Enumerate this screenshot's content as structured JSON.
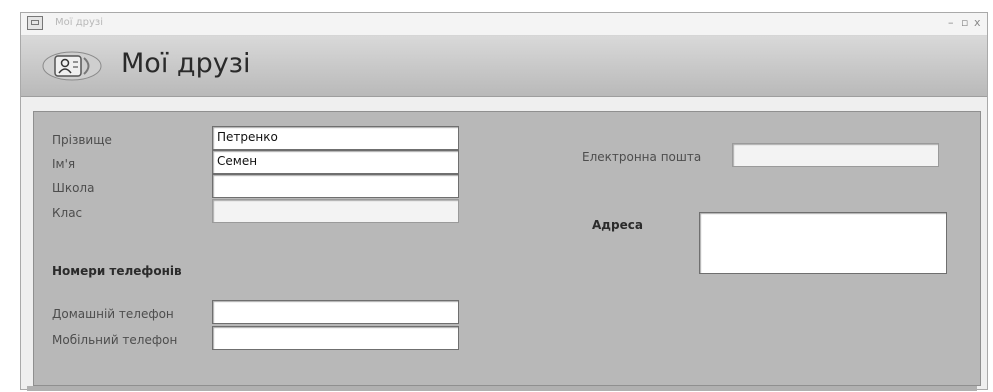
{
  "window": {
    "title": "Мої друзі",
    "minimize_glyph": "–",
    "restore_glyph": "▫",
    "close_glyph": "x"
  },
  "form": {
    "title": "Мої друзі"
  },
  "fields": {
    "surname": {
      "label": "Прізвище",
      "value": "Петренко"
    },
    "name": {
      "label": "Ім'я",
      "value": "Семен"
    },
    "school": {
      "label": "Школа",
      "value": ""
    },
    "class": {
      "label": "Клас",
      "value": ""
    },
    "phones_heading": "Номери телефонів",
    "home_phone": {
      "label": "Домашній телефон",
      "value": ""
    },
    "mobile_phone": {
      "label": "Мобільний телефон",
      "value": ""
    },
    "email": {
      "label": "Електронна пошта",
      "value": ""
    },
    "address": {
      "label": "Адреса",
      "value": ""
    }
  },
  "icons": {
    "form_icon": "contact-card-icon",
    "app_icon": "form-window-icon"
  }
}
